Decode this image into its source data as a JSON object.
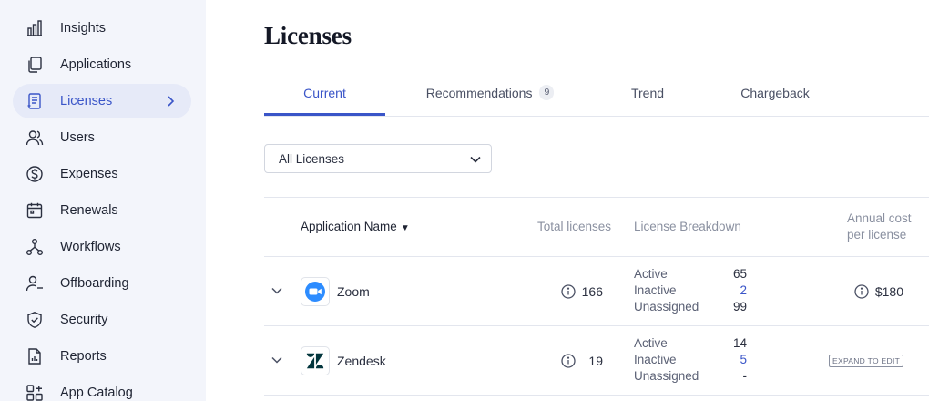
{
  "sidebar": {
    "items": [
      {
        "label": "Insights"
      },
      {
        "label": "Applications"
      },
      {
        "label": "Licenses"
      },
      {
        "label": "Users"
      },
      {
        "label": "Expenses"
      },
      {
        "label": "Renewals"
      },
      {
        "label": "Workflows"
      },
      {
        "label": "Offboarding"
      },
      {
        "label": "Security"
      },
      {
        "label": "Reports"
      },
      {
        "label": "App Catalog"
      }
    ],
    "active_index": 2,
    "accent_color": "#3a55c8"
  },
  "page": {
    "title": "Licenses"
  },
  "tabs": [
    {
      "label": "Current"
    },
    {
      "label": "Recommendations",
      "badge": "9"
    },
    {
      "label": "Trend"
    },
    {
      "label": "Chargeback"
    }
  ],
  "filter": {
    "selected": "All Licenses"
  },
  "table": {
    "columns": {
      "name": "Application Name",
      "name_sort_icon": "▼",
      "total": "Total licenses",
      "breakdown": "License Breakdown",
      "cost": "Annual cost per license"
    },
    "rows": [
      {
        "app_name": "Zoom",
        "logo_icon": "zoom-logo-icon",
        "total": "166",
        "active_label": "Active",
        "active": "65",
        "inactive_label": "Inactive",
        "inactive": "2",
        "unassigned_label": "Unassigned",
        "unassigned": "99",
        "cost": "$180"
      },
      {
        "app_name": "Zendesk",
        "logo_icon": "zendesk-logo-icon",
        "total": "19",
        "active_label": "Active",
        "active": "14",
        "inactive_label": "Inactive",
        "inactive": "5",
        "unassigned_label": "Unassigned",
        "unassigned": "-",
        "cost_action": "EXPAND TO EDIT"
      }
    ]
  }
}
